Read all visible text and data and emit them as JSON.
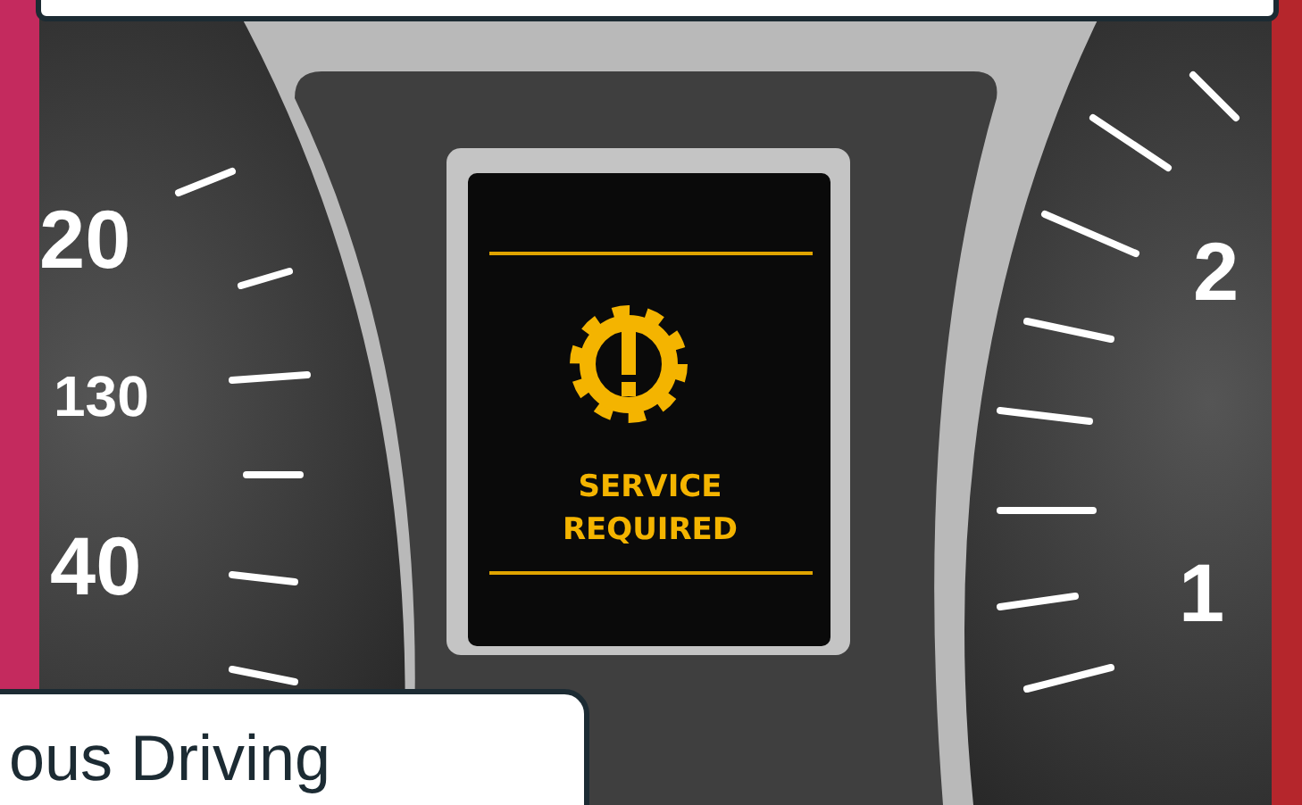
{
  "illustration": {
    "left_gauge_labels": [
      "20",
      "130",
      "40"
    ],
    "right_gauge_labels": [
      "2",
      "1"
    ],
    "warning_lines": [
      "SERVICE",
      "REQUIRED"
    ]
  },
  "card": {
    "title": "ous Driving"
  }
}
